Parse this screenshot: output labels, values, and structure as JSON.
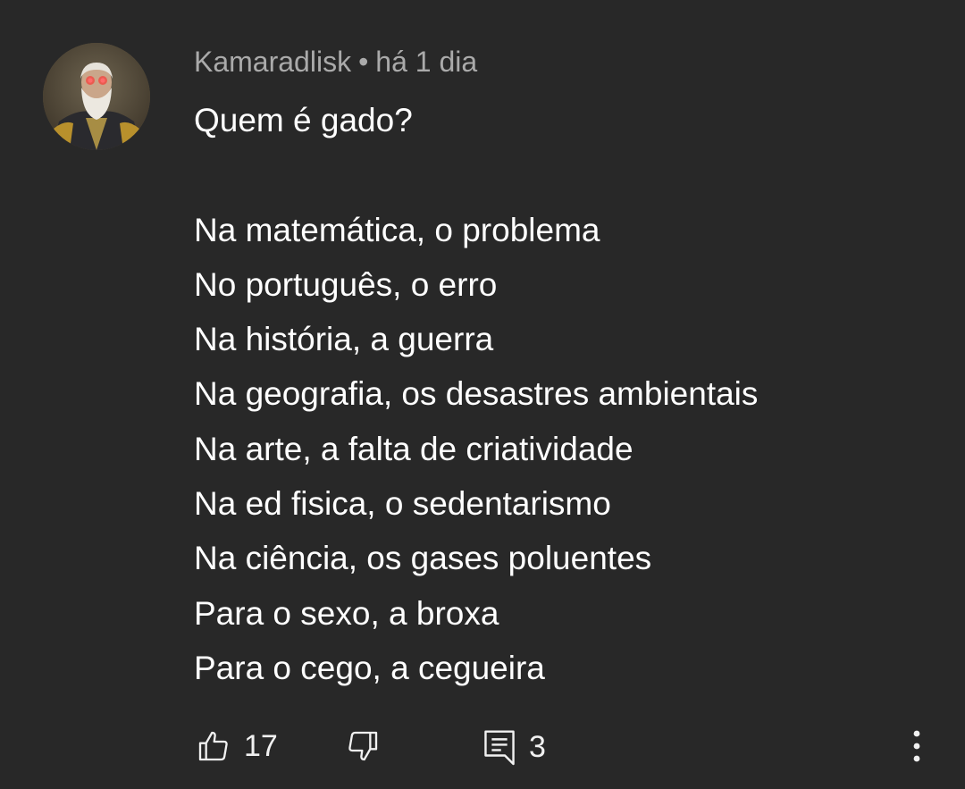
{
  "comment": {
    "author": "Kamaradlisk",
    "separator": "•",
    "timestamp": "há 1 dia",
    "lines": [
      "Quem é gado?",
      "",
      "Na matemática, o problema",
      "No português, o erro",
      "Na história, a guerra",
      "Na geografia, os desastres ambientais",
      "Na arte, a falta de criatividade",
      "Na ed fisica, o sedentarismo",
      "Na ciência, os gases poluentes",
      "Para o sexo, a broxa",
      "Para o cego, a cegueira"
    ]
  },
  "actions": {
    "like_icon": "thumbs-up-icon",
    "like_count": "17",
    "dislike_icon": "thumbs-down-icon",
    "reply_icon": "comment-icon",
    "reply_count": "3",
    "more_icon": "vertical-ellipsis-icon"
  },
  "colors": {
    "background": "#282828",
    "text_primary": "#ffffff",
    "text_secondary": "#aaaaaa"
  }
}
